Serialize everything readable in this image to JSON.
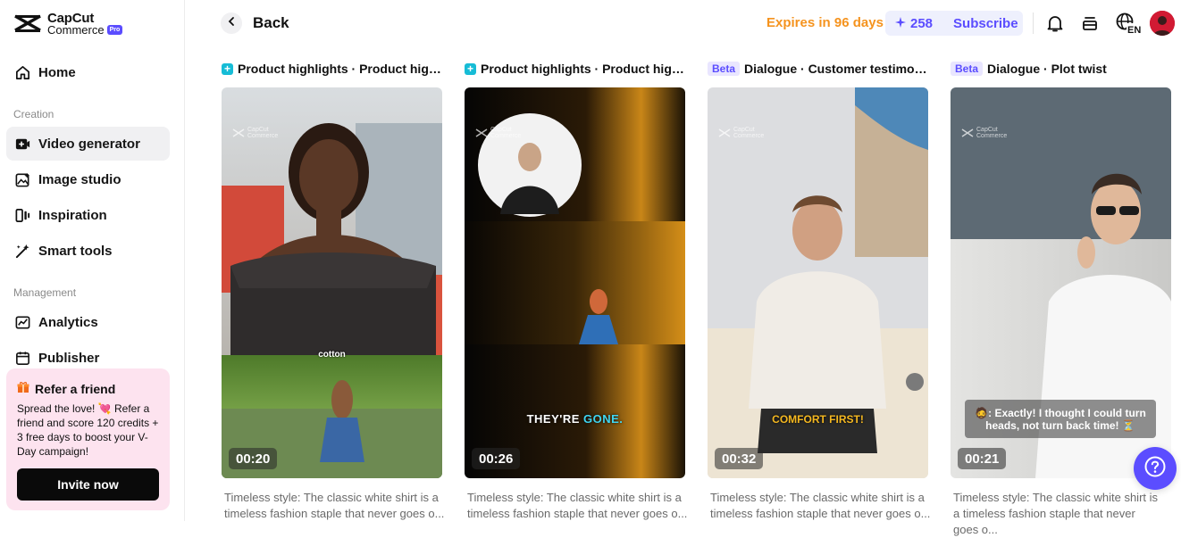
{
  "brand": {
    "name_line1": "CapCut",
    "name_line2": "Commerce",
    "badge": "Pro"
  },
  "sidebar": {
    "home": "Home",
    "section_creation": "Creation",
    "creation_items": [
      {
        "label": "Video generator",
        "icon": "video-plus-icon",
        "active": true
      },
      {
        "label": "Image studio",
        "icon": "image-sparkle-icon"
      },
      {
        "label": "Inspiration",
        "icon": "inspiration-icon"
      },
      {
        "label": "Smart tools",
        "icon": "magic-wand-icon"
      }
    ],
    "section_management": "Management",
    "management_items": [
      {
        "label": "Analytics",
        "icon": "chart-icon"
      },
      {
        "label": "Publisher",
        "icon": "calendar-icon"
      }
    ]
  },
  "refer": {
    "title": "Refer a friend",
    "body": "Spread the love! 💘 Refer a friend and score 120 credits + 3 free days to boost your V-Day campaign!",
    "button": "Invite now"
  },
  "header": {
    "back": "Back",
    "expires": "Expires in 96 days",
    "credits": "258",
    "subscribe": "Subscribe",
    "lang": "EN"
  },
  "colors": {
    "accent": "#5b4dff",
    "expires": "#f5931e",
    "refer_bg": "#fde3ef"
  },
  "cards": [
    {
      "badge_type": "plus",
      "title": "Product highlights · Product highl...",
      "duration": "00:20",
      "caption": "cotton",
      "description": "Timeless style: The classic white shirt is a timeless fashion staple that never goes o..."
    },
    {
      "badge_type": "plus",
      "title": "Product highlights · Product highl...",
      "duration": "00:26",
      "caption_a": "THEY'RE ",
      "caption_b": "GONE.",
      "description": "Timeless style: The classic white shirt is a timeless fashion staple that never goes o..."
    },
    {
      "badge_type": "beta",
      "badge": "Beta",
      "title": "Dialogue · Customer testimonial",
      "duration": "00:32",
      "caption": "COMFORT FIRST!",
      "description": "Timeless style: The classic white shirt is a timeless fashion staple that never goes o..."
    },
    {
      "badge_type": "beta",
      "badge": "Beta",
      "title": "Dialogue · Plot twist",
      "duration": "00:21",
      "caption": "🧔: Exactly! I thought I could turn heads, not turn back time! ⏳",
      "description": "Timeless style: The classic white shirt is a timeless fashion staple that never goes o..."
    }
  ],
  "watermark": {
    "line1": "CapCut",
    "line2": "Commerce"
  }
}
